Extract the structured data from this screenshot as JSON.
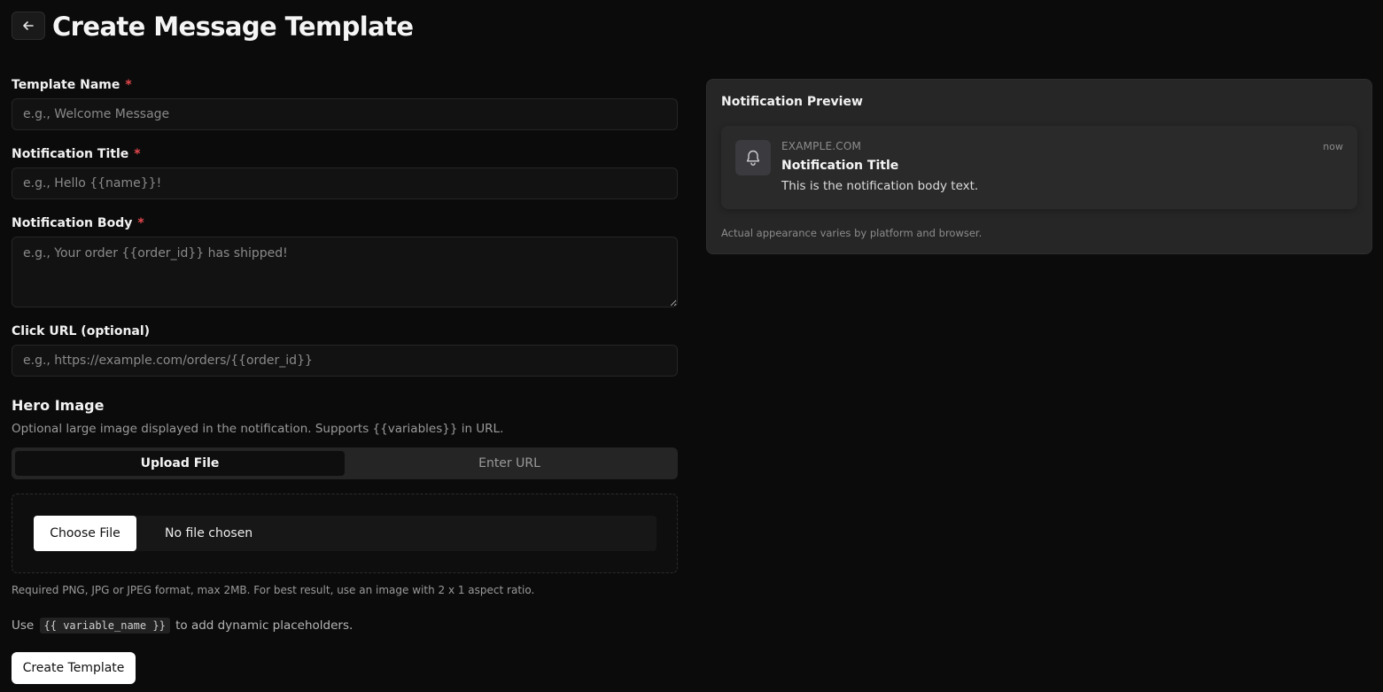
{
  "header": {
    "title": "Create Message Template",
    "back_icon": "arrow-left-icon"
  },
  "form": {
    "template_name": {
      "label": "Template Name",
      "required_mark": "*",
      "placeholder": "e.g., Welcome Message",
      "value": ""
    },
    "notification_title": {
      "label": "Notification Title",
      "required_mark": "*",
      "placeholder": "e.g., Hello {{name}}!",
      "value": ""
    },
    "notification_body": {
      "label": "Notification Body",
      "required_mark": "*",
      "placeholder": "e.g., Your order {{order_id}} has shipped!",
      "value": ""
    },
    "click_url": {
      "label": "Click URL (optional)",
      "placeholder": "e.g., https://example.com/orders/{{order_id}}",
      "value": ""
    },
    "hero_image": {
      "title": "Hero Image",
      "description": "Optional large image displayed in the notification. Supports {{variables}} in URL.",
      "tabs": [
        {
          "label": "Upload File",
          "active": true
        },
        {
          "label": "Enter URL",
          "active": false
        }
      ],
      "choose_file_label": "Choose File",
      "no_file_text": "No file chosen",
      "hint": "Required PNG, JPG or JPEG format, max 2MB. For best result, use an image with 2 x 1 aspect ratio."
    },
    "variable_hint": {
      "prefix": "Use",
      "code": "{{ variable_name }}",
      "suffix": "to add dynamic placeholders."
    },
    "submit_label": "Create Template"
  },
  "preview": {
    "title": "Notification Preview",
    "icon": "bell-icon",
    "domain": "EXAMPLE.COM",
    "time": "now",
    "notification_title": "Notification Title",
    "notification_body": "This is the notification body text.",
    "footnote": "Actual appearance varies by platform and browser."
  },
  "colors": {
    "background": "#0b0b0b",
    "required": "#e5484d",
    "primary_button": "#ffffff"
  }
}
